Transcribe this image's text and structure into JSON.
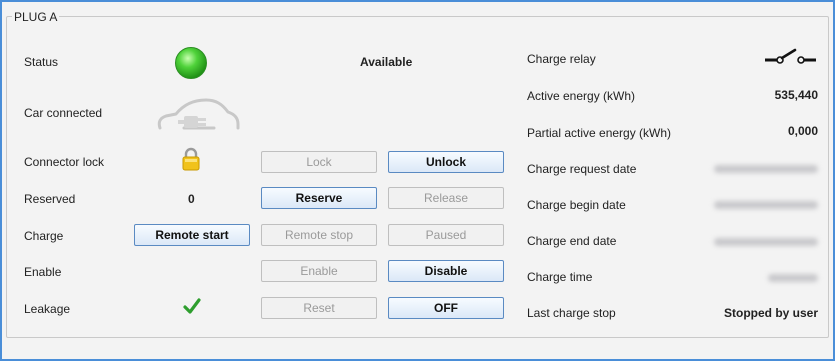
{
  "group_title": "PLUG A",
  "left": {
    "status": {
      "label": "Status",
      "value": "Available"
    },
    "car_connected": {
      "label": "Car connected"
    },
    "connector_lock": {
      "label": "Connector lock",
      "lock_btn": "Lock",
      "unlock_btn": "Unlock"
    },
    "reserved": {
      "label": "Reserved",
      "value": "0",
      "reserve_btn": "Reserve",
      "release_btn": "Release"
    },
    "charge": {
      "label": "Charge",
      "remote_start_btn": "Remote start",
      "remote_stop_btn": "Remote stop",
      "paused_btn": "Paused"
    },
    "enable": {
      "label": "Enable",
      "enable_btn": "Enable",
      "disable_btn": "Disable"
    },
    "leakage": {
      "label": "Leakage",
      "reset_btn": "Reset",
      "off_btn": "OFF"
    }
  },
  "right": {
    "charge_relay": {
      "label": "Charge relay"
    },
    "active_energy": {
      "label": "Active energy (kWh)",
      "value": "535,440"
    },
    "partial_energy": {
      "label": "Partial active energy (kWh)",
      "value": "0,000"
    },
    "charge_request_date": {
      "label": "Charge request date"
    },
    "charge_begin_date": {
      "label": "Charge begin date"
    },
    "charge_end_date": {
      "label": "Charge end date"
    },
    "charge_time": {
      "label": "Charge time"
    },
    "last_charge_stop": {
      "label": "Last charge stop",
      "value": "Stopped by user"
    }
  },
  "colors": {
    "frame_border": "#4a8ed8",
    "status_led": "#3fbf2a",
    "lock_icon": "#e6b700",
    "check_icon": "#2e9e2e"
  },
  "icons": {
    "status": "green-led-icon",
    "car": "car-plug-icon",
    "lock": "padlock-icon",
    "leakage": "check-icon",
    "relay": "relay-switch-icon"
  }
}
